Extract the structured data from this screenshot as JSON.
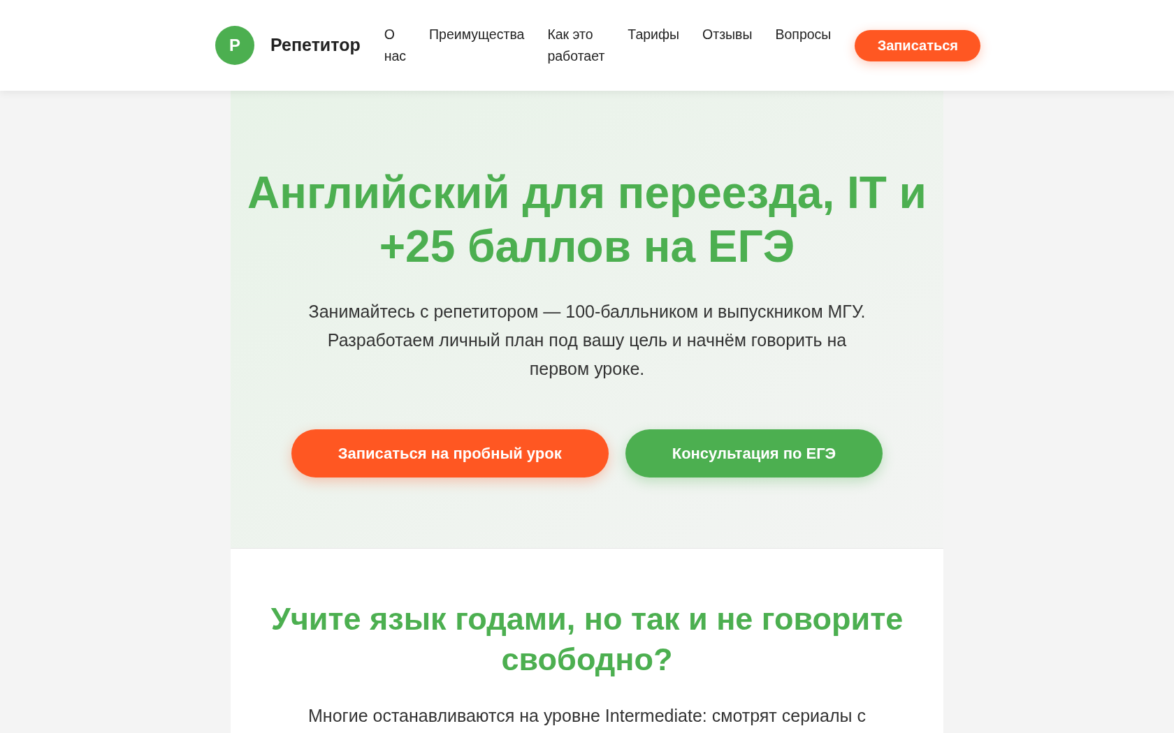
{
  "header": {
    "logo": {
      "letter": "Р",
      "title": "Репетитор"
    },
    "nav": [
      {
        "label": "О нас"
      },
      {
        "label": "Преимущества"
      },
      {
        "label": "Как это работает"
      },
      {
        "label": "Тарифы"
      },
      {
        "label": "Отзывы"
      },
      {
        "label": "Вопросы"
      }
    ],
    "cta": {
      "label": "Записаться"
    }
  },
  "hero": {
    "title": "Английский для переезда, IT и +25 баллов на ЕГЭ",
    "subtitle": "Занимайтесь с репетитором — 100-балльником и выпускником МГУ. Разработаем личный план под вашу цель и начнём говорить на первом уроке.",
    "buttons": [
      {
        "label": "Записаться на пробный урок",
        "kind": "primary"
      },
      {
        "label": "Консультация по ЕГЭ",
        "kind": "secondary"
      }
    ]
  },
  "problem": {
    "title": "Учите язык годами, но так и не говорите свободно?",
    "text": "Многие останавливаются на уровне Intermediate: смотрят сериалы с"
  }
}
